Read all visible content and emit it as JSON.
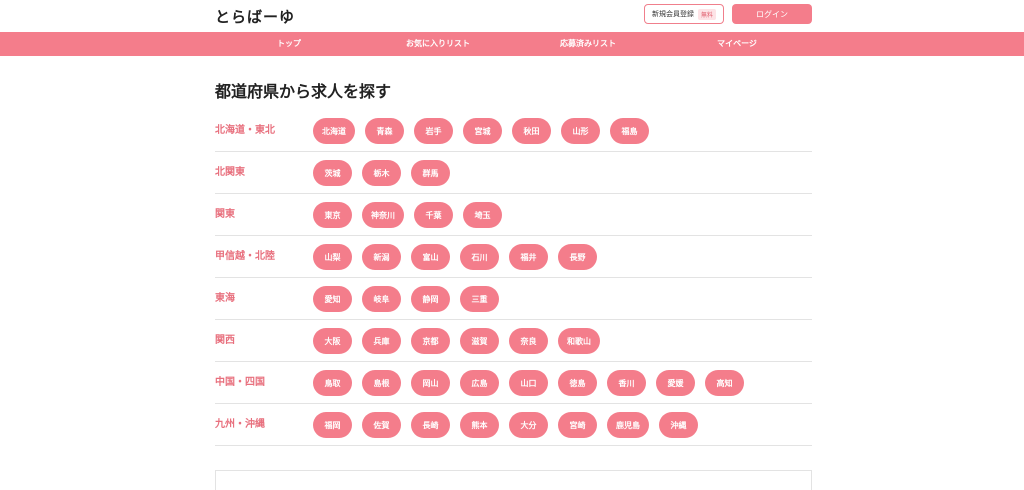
{
  "header": {
    "logo": "とらばーゆ",
    "register_label": "新規会員登録",
    "register_badge": "無料",
    "login_label": "ログイン"
  },
  "nav": [
    "トップ",
    "お気に入りリスト",
    "応募済みリスト",
    "マイページ"
  ],
  "main": {
    "title": "都道府県から求人を探す",
    "regions": [
      {
        "label": "北海道・東北",
        "prefs": [
          "北海道",
          "青森",
          "岩手",
          "宮城",
          "秋田",
          "山形",
          "福島"
        ]
      },
      {
        "label": "北関東",
        "prefs": [
          "茨城",
          "栃木",
          "群馬"
        ]
      },
      {
        "label": "関東",
        "prefs": [
          "東京",
          "神奈川",
          "千葉",
          "埼玉"
        ]
      },
      {
        "label": "甲信越・北陸",
        "prefs": [
          "山梨",
          "新潟",
          "富山",
          "石川",
          "福井",
          "長野"
        ]
      },
      {
        "label": "東海",
        "prefs": [
          "愛知",
          "岐阜",
          "静岡",
          "三重"
        ]
      },
      {
        "label": "関西",
        "prefs": [
          "大阪",
          "兵庫",
          "京都",
          "滋賀",
          "奈良",
          "和歌山"
        ]
      },
      {
        "label": "中国・四国",
        "prefs": [
          "鳥取",
          "島根",
          "岡山",
          "広島",
          "山口",
          "徳島",
          "香川",
          "愛媛",
          "高知"
        ]
      },
      {
        "label": "九州・沖縄",
        "prefs": [
          "福岡",
          "佐賀",
          "長崎",
          "熊本",
          "大分",
          "宮崎",
          "鹿児島",
          "沖縄"
        ]
      }
    ]
  },
  "colors": {
    "accent": "#f47d8b",
    "region_label": "#e8707e"
  }
}
